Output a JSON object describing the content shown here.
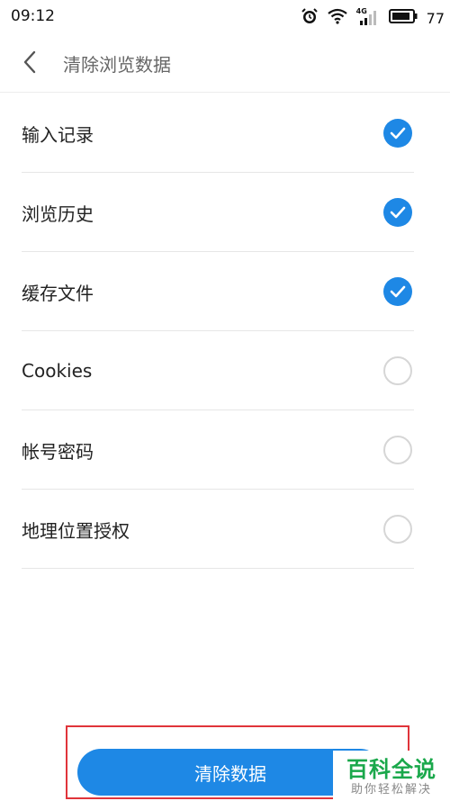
{
  "status_bar": {
    "time": "09:12",
    "network": "4G",
    "battery": "77",
    "icons": [
      "alarm-icon",
      "wifi-icon",
      "signal-icon",
      "battery-icon"
    ]
  },
  "header": {
    "back_icon": "chevron-left-icon",
    "title": "清除浏览数据"
  },
  "items": [
    {
      "label": "输入记录",
      "checked": true
    },
    {
      "label": "浏览历史",
      "checked": true
    },
    {
      "label": "缓存文件",
      "checked": true
    },
    {
      "label": "Cookies",
      "checked": false
    },
    {
      "label": "帐号密码",
      "checked": false
    },
    {
      "label": "地理位置授权",
      "checked": false
    }
  ],
  "clear_button": {
    "label": "清除数据"
  },
  "watermark": {
    "title": "百科全说",
    "subtitle": "助你轻松解决"
  },
  "colors": {
    "accent": "#1e88e5",
    "highlight": "#e0343a",
    "watermark": "#1aa84b"
  }
}
